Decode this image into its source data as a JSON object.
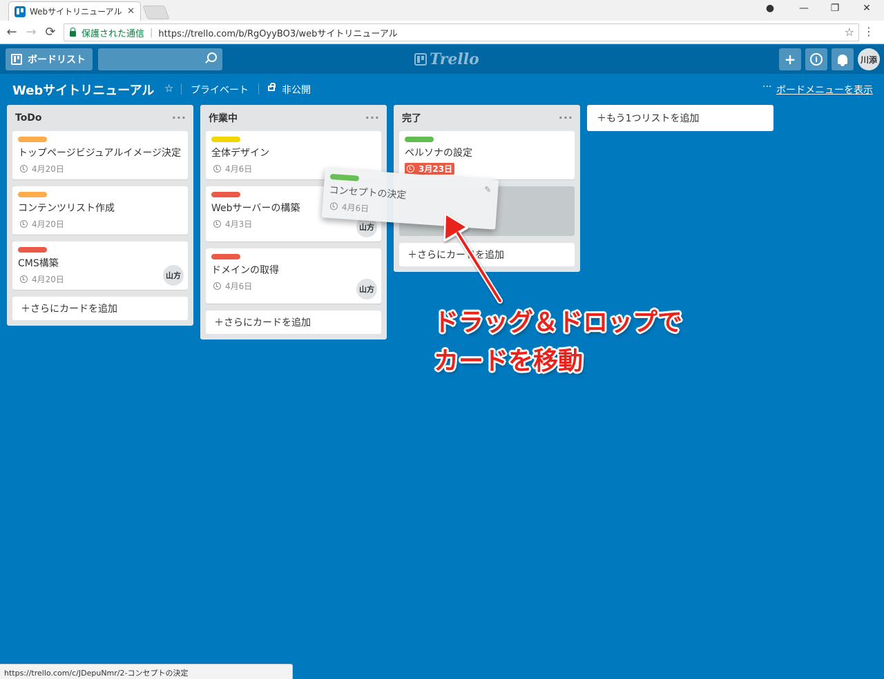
{
  "browser": {
    "tab_title": "Webサイトリニューアル | Trel",
    "tab_close": "✕",
    "secure_label": "保護された通信",
    "url": "https://trello.com/b/RgOyyBO3/webサイトリニューアル",
    "back": "←",
    "forward": "→",
    "reload": "⟳",
    "bookmark_star": "☆",
    "menu": "⋮",
    "profile_icon": "●",
    "minimize": "—",
    "maximize": "❐",
    "close": "✕"
  },
  "header": {
    "boards_label": "ボードリスト",
    "logo_text": "Trello",
    "add_icon": "+",
    "info_icon": "i",
    "avatar": "川添"
  },
  "board": {
    "title": "Webサイトリニューアル",
    "star": "☆",
    "visibility": "プライベート",
    "privacy": "非公開",
    "menu_dots": "···",
    "show_menu": "ボードメニューを表示"
  },
  "lists": [
    {
      "title": "ToDo",
      "menu": "···",
      "cards": [
        {
          "label_color": "#ffab4a",
          "title": "トップページビジュアルイメージ決定",
          "due": "4月20日"
        },
        {
          "label_color": "#ffab4a",
          "title": "コンテンツリスト作成",
          "due": "4月20日"
        },
        {
          "label_color": "#eb5a46",
          "title": "CMS構築",
          "due": "4月20日",
          "member": "山方"
        }
      ],
      "add_card": "＋さらにカードを追加"
    },
    {
      "title": "作業中",
      "menu": "···",
      "cards": [
        {
          "label_color": "#f2d600",
          "title": "全体デザイン",
          "due": "4月6日"
        },
        {
          "label_color": "#eb5a46",
          "title": "Webサーバーの構築",
          "due": "4月3日",
          "member": "山方"
        },
        {
          "label_color": "#eb5a46",
          "title": "ドメインの取得",
          "due": "4月6日",
          "member": "山方"
        }
      ],
      "add_card": "＋さらにカードを追加"
    },
    {
      "title": "完了",
      "menu": "···",
      "cards": [
        {
          "label_color": "#61bd4f",
          "title": "ペルソナの設定",
          "due": "3月23日",
          "overdue": true
        }
      ],
      "add_card": "＋さらにカードを追加"
    }
  ],
  "add_list": "＋もう1つリストを追加",
  "dragged_card": {
    "label_color": "#61bd4f",
    "title": "コンセプトの決定",
    "due": "4月6日",
    "edit_icon": "✎"
  },
  "annotation": {
    "line1": "ドラッグ＆ドロップで",
    "line2": "カードを移動",
    "color": "#e8231b"
  },
  "status_bar": "https://trello.com/c/JDepuNmr/2-コンセプトの決定"
}
